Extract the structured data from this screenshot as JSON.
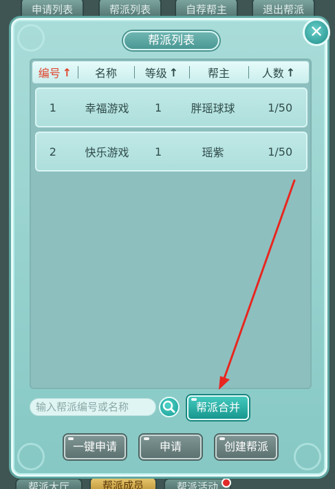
{
  "background_tabs_top": [
    "申请列表",
    "帮派列表",
    "自荐帮主",
    "退出帮派"
  ],
  "background_tabs_bottom": [
    "帮派大厅",
    "帮派成员",
    "帮派活动"
  ],
  "dialog": {
    "title": "帮派列表",
    "close_icon": "close-x-icon"
  },
  "table": {
    "columns": [
      {
        "label": "编号",
        "sort": "↑",
        "active": true
      },
      {
        "label": "名称",
        "sort": "",
        "active": false
      },
      {
        "label": "等级",
        "sort": "↑",
        "active": false
      },
      {
        "label": "帮主",
        "sort": "",
        "active": false
      },
      {
        "label": "人数",
        "sort": "↑",
        "active": false
      }
    ],
    "rows": [
      {
        "id": "1",
        "name": "幸福游戏",
        "level": "1",
        "leader": "胖瑶球球",
        "members": "1/50"
      },
      {
        "id": "2",
        "name": "快乐游戏",
        "level": "1",
        "leader": "瑶紫",
        "members": "1/50"
      }
    ]
  },
  "search": {
    "placeholder": "输入帮派编号或名称",
    "icon": "search-icon"
  },
  "buttons": {
    "merge": "帮派合并",
    "apply_all": "一键申请",
    "apply": "申请",
    "create": "创建帮派"
  },
  "colors": {
    "accent_teal": "#18978f",
    "active_sort": "#e0452e",
    "annotation_arrow": "#e8261f"
  }
}
